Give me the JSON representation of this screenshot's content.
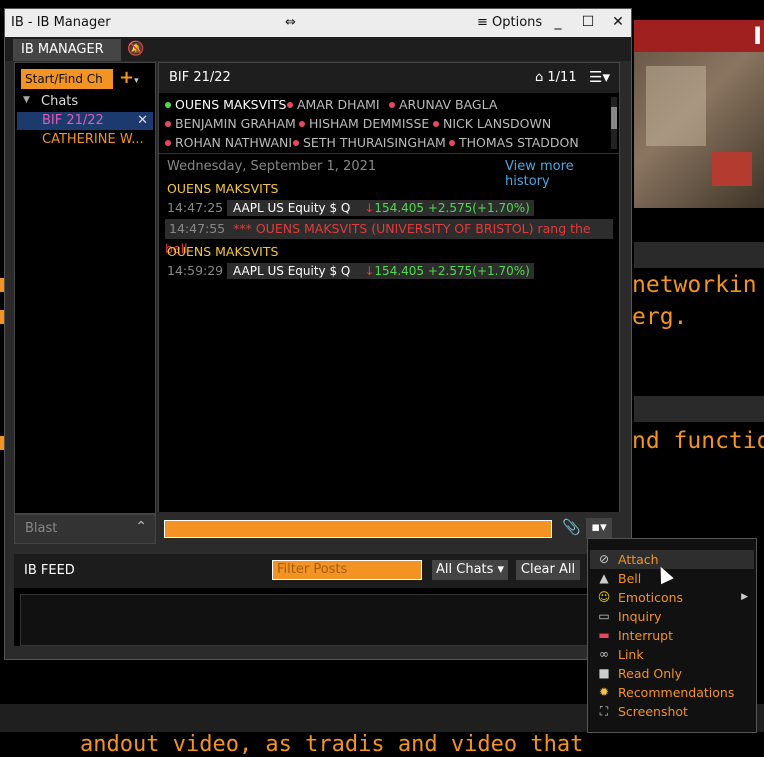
{
  "window": {
    "title": "IB - IB Manager",
    "options_label": "Options",
    "tab_label": "IB MANAGER"
  },
  "sidebar": {
    "start_find_placeholder": "Start/Find Ch",
    "plus_label": "+",
    "section_label": "Chats",
    "chats": [
      {
        "label": "BIF 21/22"
      },
      {
        "label": "CATHERINE W..."
      }
    ],
    "blast_label": "Blast"
  },
  "chat": {
    "title": "BIF 21/22",
    "position": "1/11",
    "participants": [
      {
        "name": "OUENS MAKSVITS",
        "status": "online"
      },
      {
        "name": "AMAR DHAMI",
        "status": "offline"
      },
      {
        "name": "ARUNAV BAGLA",
        "status": "offline"
      },
      {
        "name": "BENJAMIN GRAHAM",
        "status": "offline"
      },
      {
        "name": "HISHAM DEMMISSE",
        "status": "offline"
      },
      {
        "name": "NICK LANSDOWN",
        "status": "offline"
      },
      {
        "name": "ROHAN NATHWANI",
        "status": "offline"
      },
      {
        "name": "SETH THURAISINGHAM",
        "status": "offline"
      },
      {
        "name": "THOMAS STADDON",
        "status": "offline"
      }
    ],
    "date": "Wednesday, September 1, 2021",
    "view_more": "View more history",
    "messages": [
      {
        "sender": "OUENS MAKSVITS",
        "time": "14:47:25",
        "symbol": "AAPL  US Equity $  Q",
        "arrow": "↓",
        "quote": "154.405 +2.575(+1.70%)"
      },
      {
        "time": "14:47:55",
        "text": "*** OUENS MAKSVITS (UNIVERSITY OF BRISTOL) rang the bell"
      },
      {
        "sender": "OUENS MAKSVITS",
        "time": "14:59:29",
        "symbol": "AAPL  US Equity $  Q",
        "arrow": "↓",
        "quote": "154.405 +2.575(+1.70%)"
      }
    ]
  },
  "feed": {
    "title": "IB FEED",
    "filter_placeholder": "Filter Posts",
    "all_chats": "All Chats",
    "clear_all": "Clear All"
  },
  "context_menu": {
    "items": [
      {
        "label": "Attach",
        "icon": "paperclip-icon"
      },
      {
        "label": "Bell",
        "icon": "bell-icon"
      },
      {
        "label": "Emoticons",
        "icon": "smiley-icon"
      },
      {
        "label": "Inquiry",
        "icon": "inquiry-icon"
      },
      {
        "label": "Interrupt",
        "icon": "interrupt-icon"
      },
      {
        "label": "Link",
        "icon": "link-icon"
      },
      {
        "label": "Read Only",
        "icon": "lock-icon"
      },
      {
        "label": "Recommendations",
        "icon": "award-icon"
      },
      {
        "label": "Screenshot",
        "icon": "screenshot-icon"
      }
    ]
  },
  "background": {
    "top_right_letter": "I",
    "text1": "networkin",
    "text2": "erg.",
    "text3": "nd functio",
    "bottom_text": "andout video, as tradis and video that"
  },
  "colors": {
    "accent": "#f39323",
    "online": "#4cdc4c",
    "offline": "#e8495c",
    "bell": "#e03c3c",
    "link": "#4aa8e0",
    "sender": "#f5c542"
  }
}
